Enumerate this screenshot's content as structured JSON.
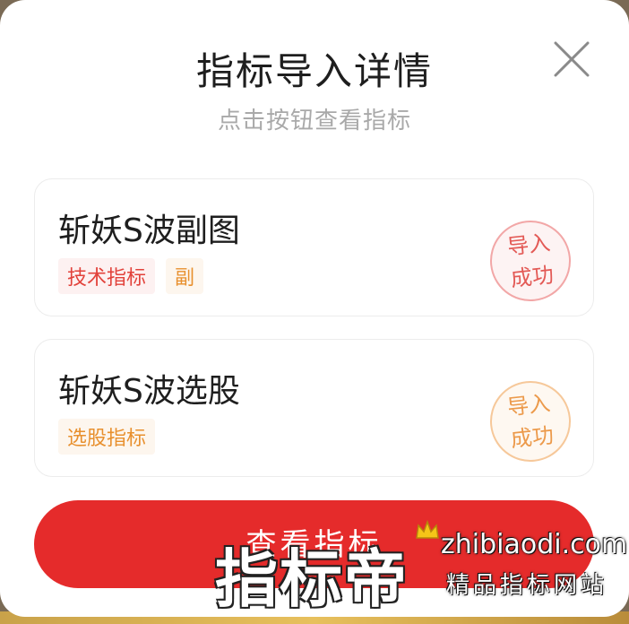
{
  "dialog": {
    "title": "指标导入详情",
    "subtitle": "点击按钮查看指标",
    "close_icon": "close-icon"
  },
  "items": [
    {
      "name": "斩妖S波副图",
      "tags": [
        {
          "label": "技术指标",
          "color": "#e2423b"
        },
        {
          "label": "副",
          "color": "#e8902e"
        }
      ],
      "stamp": {
        "line1": "导入",
        "line2": "成功",
        "color": "#e35a56"
      }
    },
    {
      "name": "斩妖S波选股",
      "tags": [
        {
          "label": "选股指标",
          "color": "#e8902e"
        }
      ],
      "stamp": {
        "line1": "导入",
        "line2": "成功",
        "color": "#ec9a4b"
      }
    }
  ],
  "primary_button": {
    "label": "查看指标",
    "color": "#e52b2b"
  },
  "watermark": {
    "brand": "指标帝",
    "domain": "zhibiaodi.com",
    "slogan": "精品指标网站",
    "crown_icon": "crown-icon"
  }
}
